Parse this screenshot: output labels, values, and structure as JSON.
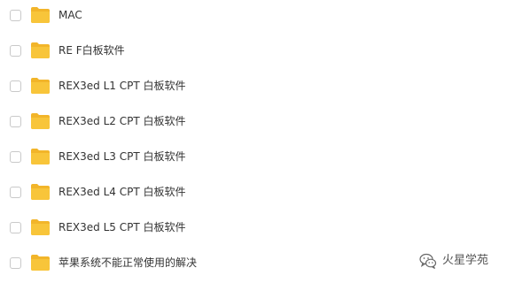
{
  "folders": [
    {
      "name": "MAC",
      "icon": "folder-icon",
      "checked": false
    },
    {
      "name": "RE F白板软件",
      "icon": "folder-icon",
      "checked": false
    },
    {
      "name": "REX3ed L1 CPT 白板软件",
      "icon": "folder-icon",
      "checked": false
    },
    {
      "name": "REX3ed L2 CPT 白板软件",
      "icon": "folder-icon",
      "checked": false
    },
    {
      "name": "REX3ed L3 CPT 白板软件",
      "icon": "folder-icon",
      "checked": false
    },
    {
      "name": "REX3ed L4 CPT 白板软件",
      "icon": "folder-icon",
      "checked": false
    },
    {
      "name": "REX3ed L5 CPT 白板软件",
      "icon": "folder-icon",
      "checked": false
    },
    {
      "name": "苹果系统不能正常使用的解决",
      "icon": "folder-icon",
      "checked": false
    }
  ],
  "watermark": {
    "text": "火星学苑",
    "icon": "wechat-icon"
  },
  "colors": {
    "folder": "#f8c53a",
    "folder_tab": "#f2b52a",
    "text": "#333333",
    "checkbox_border": "#c9c9c9"
  }
}
